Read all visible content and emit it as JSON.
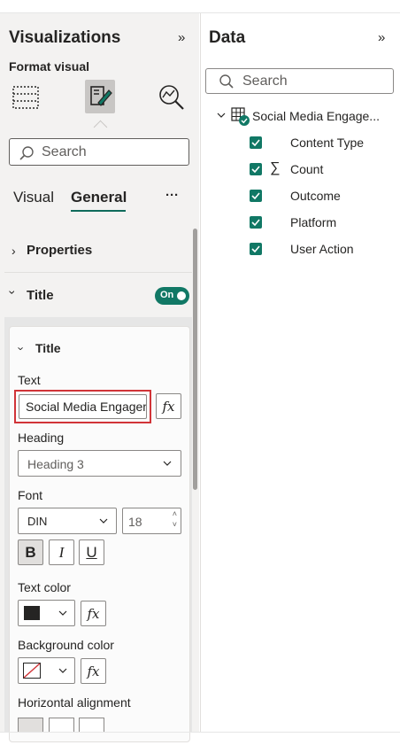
{
  "visualizations": {
    "title": "Visualizations",
    "collapse_glyph": "»",
    "format_label": "Format visual",
    "icons": [
      "table-grid-icon",
      "format-brush-icon",
      "analytics-magnifier-icon"
    ],
    "search_placeholder": "Search",
    "tabs": [
      {
        "label": "Visual",
        "active": false
      },
      {
        "label": "General",
        "active": true
      }
    ],
    "more_glyph": "···",
    "sections": {
      "properties": "Properties",
      "title": "Title",
      "toggle_label": "On"
    },
    "title_card": {
      "header": "Title",
      "text_label": "Text",
      "text_value": "Social Media Engagement",
      "fx": "fx",
      "heading_label": "Heading",
      "heading_value": "Heading 3",
      "font_label": "Font",
      "font_family": "DIN",
      "font_size": "18",
      "bold": "B",
      "italic": "I",
      "underline": "U",
      "text_color_label": "Text color",
      "text_color": "#252423",
      "background_color_label": "Background color",
      "horizontal_alignment_label": "Horizontal alignment"
    },
    "highlight_color": "#d13438",
    "accent_color": "#117865"
  },
  "data": {
    "title": "Data",
    "collapse_glyph": "»",
    "search_placeholder": "Search",
    "table_name": "Social Media Engage...",
    "fields": [
      {
        "name": "Content Type",
        "sigma": false
      },
      {
        "name": "Count",
        "sigma": true
      },
      {
        "name": "Outcome",
        "sigma": false
      },
      {
        "name": "Platform",
        "sigma": false
      },
      {
        "name": "User Action",
        "sigma": false
      }
    ]
  }
}
